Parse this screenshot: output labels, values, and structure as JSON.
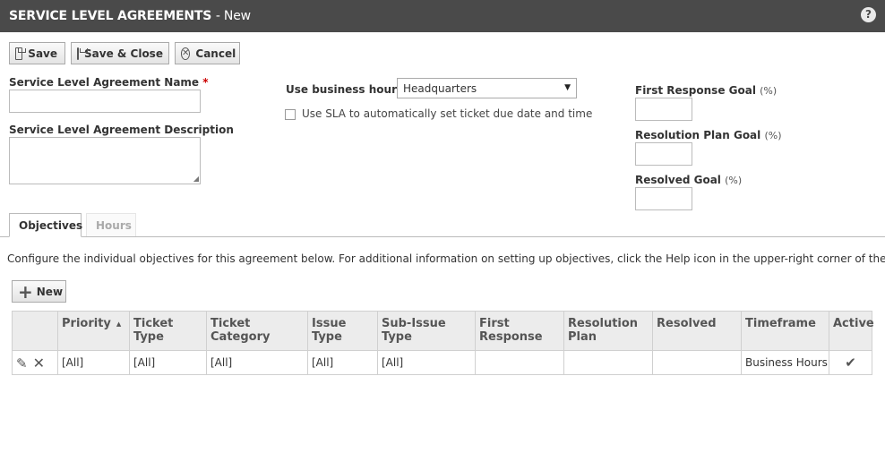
{
  "header": {
    "title": "SERVICE LEVEL AGREEMENTS",
    "subtitle": "- New",
    "help_icon": "question-circle-icon"
  },
  "toolbar": {
    "save_label": "Save",
    "save_close_label": "Save & Close",
    "cancel_label": "Cancel"
  },
  "form": {
    "name_label": "Service Level Agreement Name",
    "required_marker": "*",
    "name_value": "",
    "description_label": "Service Level Agreement Description",
    "description_value": "",
    "business_hours_label": "Use business hours of",
    "business_hours_value": "Headquarters",
    "use_sla_label": "Use SLA to automatically set ticket due date and time",
    "use_sla_checked": false,
    "first_response_label": "First Response Goal",
    "resolution_plan_label": "Resolution Plan Goal",
    "resolved_label": "Resolved Goal",
    "percent_unit": "(%)",
    "first_response_value": "",
    "resolution_plan_value": "",
    "resolved_value": ""
  },
  "tabs": [
    {
      "label": "Objectives",
      "active": true
    },
    {
      "label": "Hours",
      "active": false
    }
  ],
  "objectives": {
    "info_text": "Configure the individual objectives for this agreement below. For additional information on setting up objectives, click the Help icon in the upper-right corner of the page.",
    "new_label": "New",
    "columns": [
      "",
      "Priority",
      "Ticket Type",
      "Ticket Category",
      "Issue Type",
      "Sub-Issue Type",
      "First Response",
      "Resolution Plan",
      "Resolved",
      "Timeframe",
      "Active"
    ],
    "sort_column": "Priority",
    "sort_direction": "ascending",
    "rows": [
      {
        "priority": "[All]",
        "ticket_type": "[All]",
        "ticket_category": "[All]",
        "issue_type": "[All]",
        "sub_issue_type": "[All]",
        "first_response": "",
        "resolution_plan": "",
        "resolved": "",
        "timeframe": "Business Hours",
        "active": true
      }
    ]
  }
}
